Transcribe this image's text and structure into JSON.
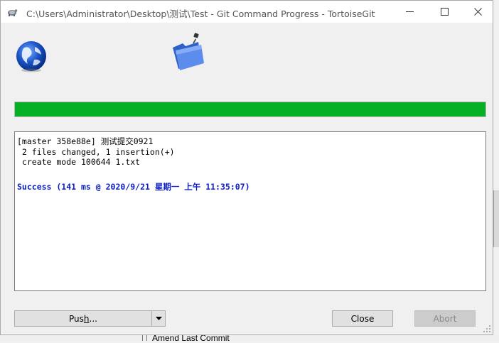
{
  "window": {
    "title": "C:\\Users\\Administrator\\Desktop\\测试\\Test - Git Command Progress - TortoiseGit",
    "minimize_icon": "minimize-icon",
    "maximize_icon": "maximize-icon",
    "close_icon": "close-icon"
  },
  "header": {
    "left_icon": "globe-icon",
    "right_icon": "folder-icon"
  },
  "progress": {
    "value": 1.0,
    "color": "#06b025"
  },
  "log": {
    "lines": [
      "[master 358e88e] 测试提交0921",
      " 2 files changed, 1 insertion(+)",
      " create mode 100644 1.txt"
    ],
    "status": "Success (141 ms @ 2020/9/21 星期一 上午 11:35:07)",
    "status_color": "#0b1dc9"
  },
  "buttons": {
    "push_label_before": "Pus",
    "push_label_mnemonic": "h",
    "push_label_after": "...",
    "dropdown_icon": "chevron-down-icon",
    "close_label": "Close",
    "abort_label": "Abort"
  },
  "background": {
    "amend_text": "Amend Last Commit"
  }
}
